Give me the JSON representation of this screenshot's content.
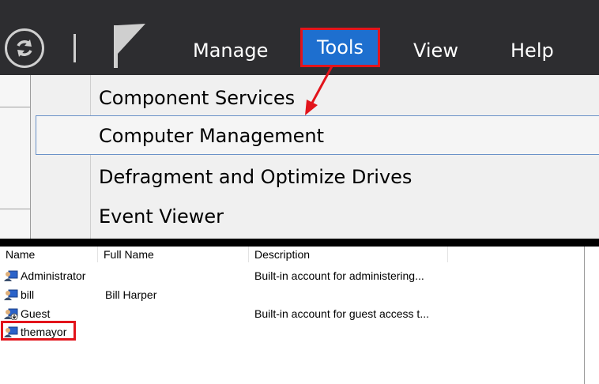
{
  "toolbar": {
    "menus": [
      "Manage",
      "Tools",
      "View",
      "Help"
    ]
  },
  "dropdown": {
    "items": [
      "Component Services",
      "Computer Management",
      "Defragment and Optimize Drives",
      "Event Viewer"
    ]
  },
  "users": {
    "columns": [
      "Name",
      "Full Name",
      "Description"
    ],
    "rows": [
      {
        "name": "Administrator",
        "full_name": "",
        "description": "Built-in account for administering..."
      },
      {
        "name": "bill",
        "full_name": "Bill Harper",
        "description": ""
      },
      {
        "name": "Guest",
        "full_name": "",
        "description": "Built-in account for guest access t..."
      },
      {
        "name": "themayor",
        "full_name": "",
        "description": ""
      }
    ]
  },
  "colors": {
    "toolbar_bg": "#2d2d30",
    "highlight_red": "#e2141b",
    "menu_selected": "#1e6fcf"
  },
  "icons": [
    "refresh-icon",
    "flag-icon",
    "user-icon",
    "guest-user-icon"
  ]
}
